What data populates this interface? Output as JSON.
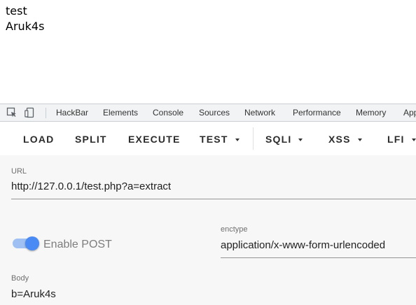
{
  "page": {
    "lines": [
      "test",
      "Aruk4s"
    ]
  },
  "devtools": {
    "tabs": [
      "HackBar",
      "Elements",
      "Console",
      "Sources",
      "Network",
      "Performance",
      "Memory",
      "Application"
    ],
    "active_tab": "HackBar",
    "icons": [
      "inspect-element-icon",
      "device-toolbar-icon"
    ]
  },
  "hackbar": {
    "buttons": {
      "load": "LOAD",
      "split": "SPLIT",
      "execute": "EXECUTE",
      "test": "TEST",
      "sqli": "SQLI",
      "xss": "XSS",
      "lfi": "LFI"
    },
    "url": {
      "label": "URL",
      "value": "http://127.0.0.1/test.php?a=extract"
    },
    "enable_post": {
      "label": "Enable POST",
      "checked": true
    },
    "enctype": {
      "label": "enctype",
      "value": "application/x-www-form-urlencoded"
    },
    "body": {
      "label": "Body",
      "value": "b=Aruk4s"
    }
  },
  "colors": {
    "accent": "#1a73e8",
    "toggle_thumb": "#4a8af4",
    "toggle_track": "#9fc0f2",
    "tabbar_bg": "#f1f3f4",
    "form_bg": "#f7f7f7"
  }
}
